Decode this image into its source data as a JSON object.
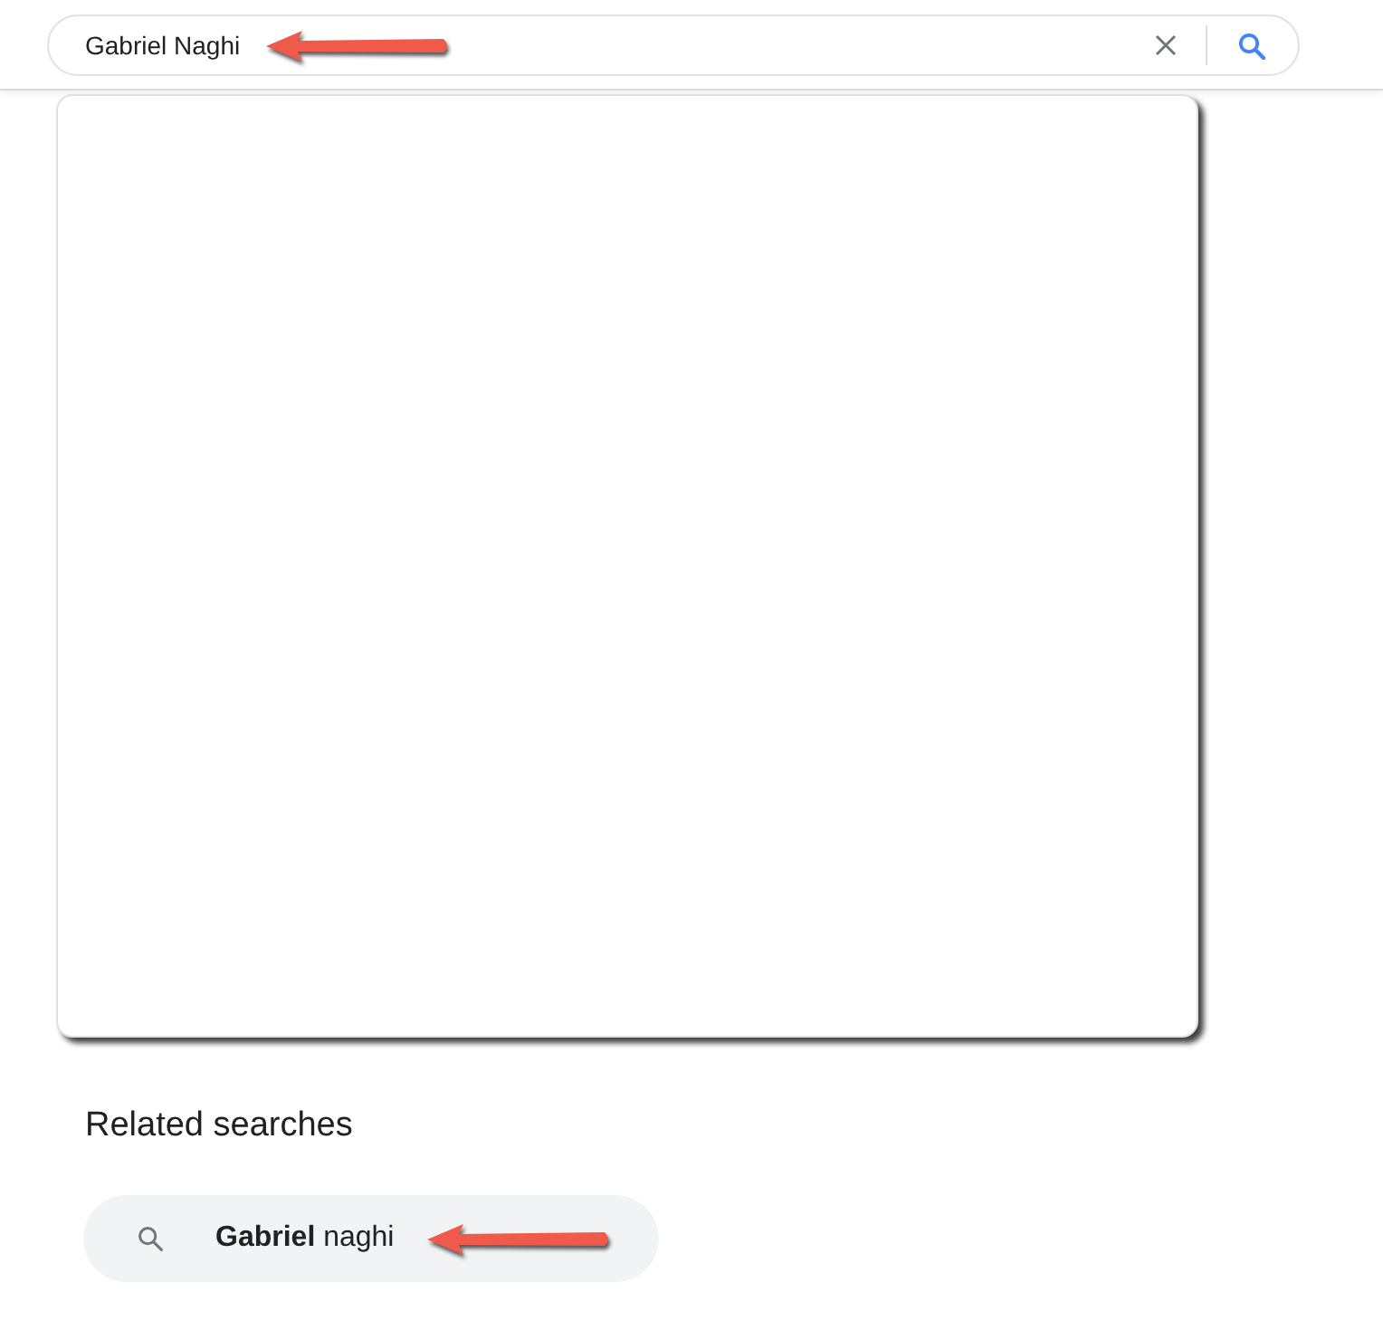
{
  "search_bar": {
    "query": "Gabriel Naghi",
    "arrowed": true
  },
  "related_searches": {
    "title": "Related searches",
    "items": [
      {
        "text": "**Gabriel** naghi",
        "arrowed": true
      }
    ]
  }
}
